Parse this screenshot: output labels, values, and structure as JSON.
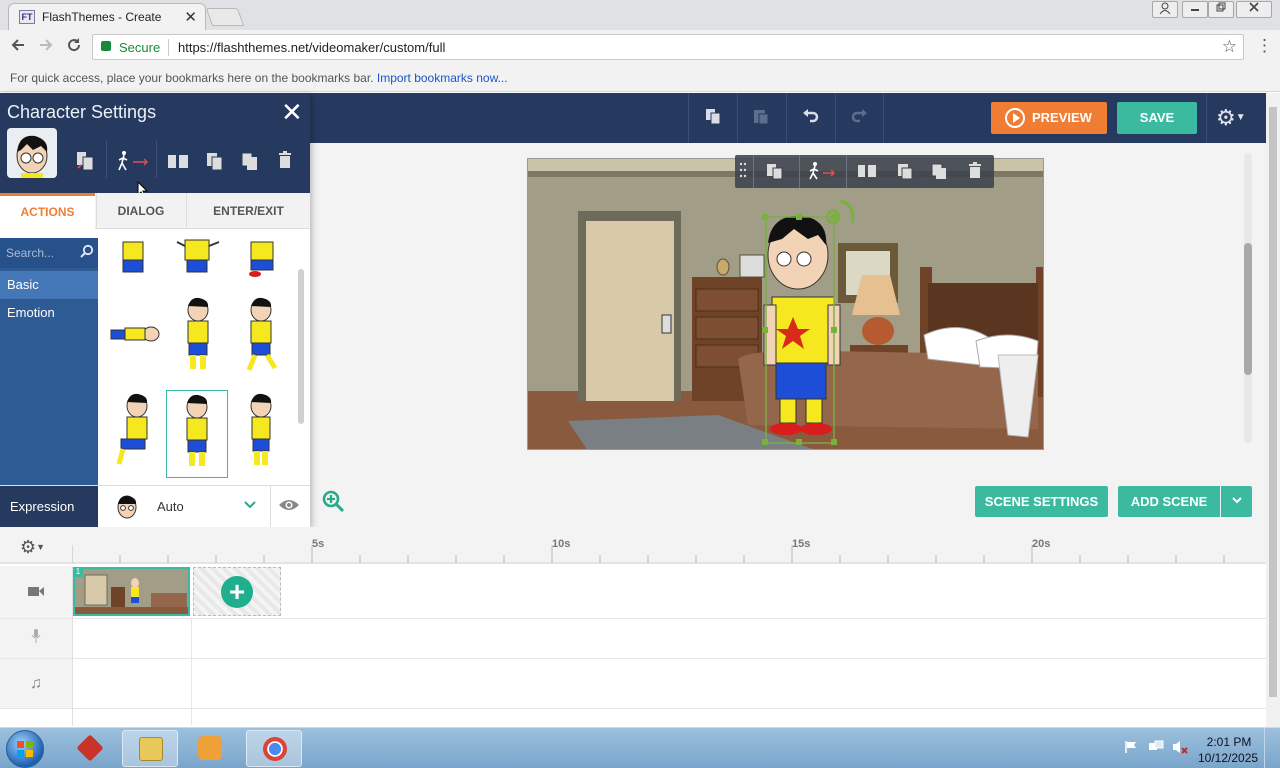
{
  "browser": {
    "tab_title": "FlashThemes - Create",
    "tab_close": "✕",
    "favicon_text": "FT",
    "secure_label": "Secure",
    "url": "https://flashthemes.net/videomaker/custom/full",
    "bookmarks_text": "For quick access, place your bookmarks here on the bookmarks bar.",
    "bookmarks_link": "Import bookmarks now..."
  },
  "app_toolbar": {
    "preview_label": "PREVIEW",
    "save_label": "SAVE"
  },
  "character_panel": {
    "title": "Character Settings",
    "tabs": [
      {
        "label": "ACTIONS",
        "active": true
      },
      {
        "label": "DIALOG",
        "active": false
      },
      {
        "label": "ENTER/EXIT",
        "active": false
      }
    ],
    "search_placeholder": "Search...",
    "categories": [
      {
        "label": "Basic",
        "selected": true
      },
      {
        "label": "Emotion",
        "selected": false
      }
    ],
    "expression_label": "Expression",
    "expression_value": "Auto"
  },
  "workspace": {
    "scene_settings_label": "SCENE SETTINGS",
    "add_scene_label": "ADD SCENE"
  },
  "timeline": {
    "ticks": [
      "5s",
      "10s",
      "15s",
      "20s"
    ],
    "scene_number": "1"
  },
  "taskbar": {
    "time": "2:01 PM",
    "date": "10/12/2025"
  },
  "colors": {
    "header_navy": "#263a5f",
    "accent_orange": "#ef7d33",
    "accent_teal": "#3cbaa0",
    "sidebar_blue": "#2f5b95"
  }
}
